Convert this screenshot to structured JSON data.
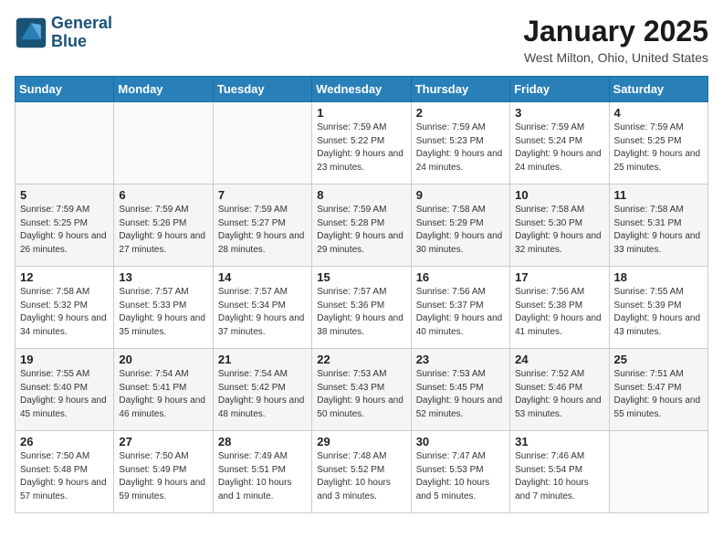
{
  "header": {
    "logo_line1": "General",
    "logo_line2": "Blue",
    "month": "January 2025",
    "location": "West Milton, Ohio, United States"
  },
  "days_of_week": [
    "Sunday",
    "Monday",
    "Tuesday",
    "Wednesday",
    "Thursday",
    "Friday",
    "Saturday"
  ],
  "weeks": [
    [
      {
        "day": "",
        "info": ""
      },
      {
        "day": "",
        "info": ""
      },
      {
        "day": "",
        "info": ""
      },
      {
        "day": "1",
        "info": "Sunrise: 7:59 AM\nSunset: 5:22 PM\nDaylight: 9 hours and 23 minutes."
      },
      {
        "day": "2",
        "info": "Sunrise: 7:59 AM\nSunset: 5:23 PM\nDaylight: 9 hours and 24 minutes."
      },
      {
        "day": "3",
        "info": "Sunrise: 7:59 AM\nSunset: 5:24 PM\nDaylight: 9 hours and 24 minutes."
      },
      {
        "day": "4",
        "info": "Sunrise: 7:59 AM\nSunset: 5:25 PM\nDaylight: 9 hours and 25 minutes."
      }
    ],
    [
      {
        "day": "5",
        "info": "Sunrise: 7:59 AM\nSunset: 5:25 PM\nDaylight: 9 hours and 26 minutes."
      },
      {
        "day": "6",
        "info": "Sunrise: 7:59 AM\nSunset: 5:26 PM\nDaylight: 9 hours and 27 minutes."
      },
      {
        "day": "7",
        "info": "Sunrise: 7:59 AM\nSunset: 5:27 PM\nDaylight: 9 hours and 28 minutes."
      },
      {
        "day": "8",
        "info": "Sunrise: 7:59 AM\nSunset: 5:28 PM\nDaylight: 9 hours and 29 minutes."
      },
      {
        "day": "9",
        "info": "Sunrise: 7:58 AM\nSunset: 5:29 PM\nDaylight: 9 hours and 30 minutes."
      },
      {
        "day": "10",
        "info": "Sunrise: 7:58 AM\nSunset: 5:30 PM\nDaylight: 9 hours and 32 minutes."
      },
      {
        "day": "11",
        "info": "Sunrise: 7:58 AM\nSunset: 5:31 PM\nDaylight: 9 hours and 33 minutes."
      }
    ],
    [
      {
        "day": "12",
        "info": "Sunrise: 7:58 AM\nSunset: 5:32 PM\nDaylight: 9 hours and 34 minutes."
      },
      {
        "day": "13",
        "info": "Sunrise: 7:57 AM\nSunset: 5:33 PM\nDaylight: 9 hours and 35 minutes."
      },
      {
        "day": "14",
        "info": "Sunrise: 7:57 AM\nSunset: 5:34 PM\nDaylight: 9 hours and 37 minutes."
      },
      {
        "day": "15",
        "info": "Sunrise: 7:57 AM\nSunset: 5:36 PM\nDaylight: 9 hours and 38 minutes."
      },
      {
        "day": "16",
        "info": "Sunrise: 7:56 AM\nSunset: 5:37 PM\nDaylight: 9 hours and 40 minutes."
      },
      {
        "day": "17",
        "info": "Sunrise: 7:56 AM\nSunset: 5:38 PM\nDaylight: 9 hours and 41 minutes."
      },
      {
        "day": "18",
        "info": "Sunrise: 7:55 AM\nSunset: 5:39 PM\nDaylight: 9 hours and 43 minutes."
      }
    ],
    [
      {
        "day": "19",
        "info": "Sunrise: 7:55 AM\nSunset: 5:40 PM\nDaylight: 9 hours and 45 minutes."
      },
      {
        "day": "20",
        "info": "Sunrise: 7:54 AM\nSunset: 5:41 PM\nDaylight: 9 hours and 46 minutes."
      },
      {
        "day": "21",
        "info": "Sunrise: 7:54 AM\nSunset: 5:42 PM\nDaylight: 9 hours and 48 minutes."
      },
      {
        "day": "22",
        "info": "Sunrise: 7:53 AM\nSunset: 5:43 PM\nDaylight: 9 hours and 50 minutes."
      },
      {
        "day": "23",
        "info": "Sunrise: 7:53 AM\nSunset: 5:45 PM\nDaylight: 9 hours and 52 minutes."
      },
      {
        "day": "24",
        "info": "Sunrise: 7:52 AM\nSunset: 5:46 PM\nDaylight: 9 hours and 53 minutes."
      },
      {
        "day": "25",
        "info": "Sunrise: 7:51 AM\nSunset: 5:47 PM\nDaylight: 9 hours and 55 minutes."
      }
    ],
    [
      {
        "day": "26",
        "info": "Sunrise: 7:50 AM\nSunset: 5:48 PM\nDaylight: 9 hours and 57 minutes."
      },
      {
        "day": "27",
        "info": "Sunrise: 7:50 AM\nSunset: 5:49 PM\nDaylight: 9 hours and 59 minutes."
      },
      {
        "day": "28",
        "info": "Sunrise: 7:49 AM\nSunset: 5:51 PM\nDaylight: 10 hours and 1 minute."
      },
      {
        "day": "29",
        "info": "Sunrise: 7:48 AM\nSunset: 5:52 PM\nDaylight: 10 hours and 3 minutes."
      },
      {
        "day": "30",
        "info": "Sunrise: 7:47 AM\nSunset: 5:53 PM\nDaylight: 10 hours and 5 minutes."
      },
      {
        "day": "31",
        "info": "Sunrise: 7:46 AM\nSunset: 5:54 PM\nDaylight: 10 hours and 7 minutes."
      },
      {
        "day": "",
        "info": ""
      }
    ]
  ]
}
